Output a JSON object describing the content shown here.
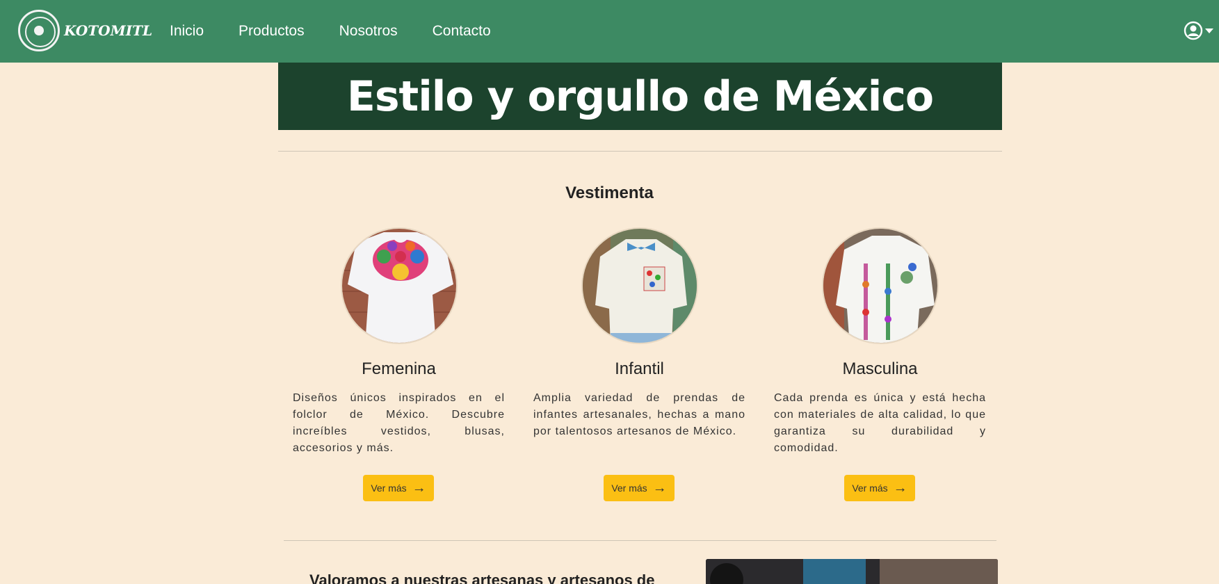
{
  "nav": {
    "brand": "KOTOMITL",
    "links": [
      "Inicio",
      "Productos",
      "Nosotros",
      "Contacto"
    ]
  },
  "hero": {
    "title": "Estilo y orgullo de México"
  },
  "section": {
    "title": "Vestimenta",
    "cards": [
      {
        "title": "Femenina",
        "text": "Diseños únicos inspirados en el folclor de México. Descubre increíbles vestidos, blusas, accesorios y más.",
        "button": "Ver más"
      },
      {
        "title": "Infantil",
        "text": "Amplia variedad de prendas de infantes artesanales, hechas a mano por talentosos artesanos de México.",
        "button": "Ver más"
      },
      {
        "title": "Masculina",
        "text": "Cada prenda es única y está hecha con materiales de alta calidad, lo que garantiza su durabilidad y comodidad.",
        "button": "Ver más"
      }
    ]
  },
  "bottom": {
    "heading": "Valoramos a nuestras artesanas y artesanos de"
  },
  "colors": {
    "navbar": "#3d8a63",
    "hero": "#1c432d",
    "background": "#faebd7",
    "button": "#fbbf13"
  },
  "icons": {
    "user": "user-circle-icon",
    "caret": "caret-down-icon",
    "arrow": "arrow-right-icon"
  }
}
